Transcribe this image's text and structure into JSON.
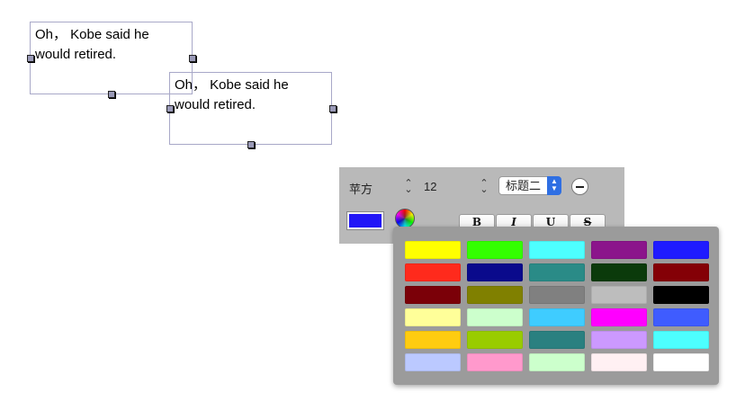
{
  "textboxes": [
    {
      "text": "Oh， Kobe said he would retired."
    },
    {
      "text": "Oh， Kobe said he would retired."
    }
  ],
  "toolbar": {
    "font_name": "苹方",
    "font_size": "12",
    "style_select": "标题二",
    "bold_label": "B",
    "italic_label": "I",
    "underline_label": "U",
    "strike_label": "S",
    "current_color": "#2116f7",
    "stepper_icon": "up-down-chevron-icon",
    "minus_icon": "minus-circle-icon",
    "wheel_icon": "color-wheel-icon"
  },
  "palette": {
    "rows": [
      [
        "#ffff00",
        "#33ff00",
        "#4dffff",
        "#8b148b",
        "#1f1bff"
      ],
      [
        "#ff2a1c",
        "#0a0a8c",
        "#2a8b87",
        "#0b3a0b",
        "#840006"
      ],
      [
        "#7b0008",
        "#808000",
        "#808080",
        "#bdbdbd",
        "#000000"
      ],
      [
        "#ffff99",
        "#ccffcc",
        "#3fccff",
        "#ff00ff",
        "#3f5cff"
      ],
      [
        "#ffcc10",
        "#99cc00",
        "#2a8080",
        "#cc99ff",
        "#4dffff"
      ],
      [
        "#bbc9ff",
        "#ff99cc",
        "#ccffcc",
        "#fff0f3",
        "#ffffff"
      ]
    ]
  }
}
